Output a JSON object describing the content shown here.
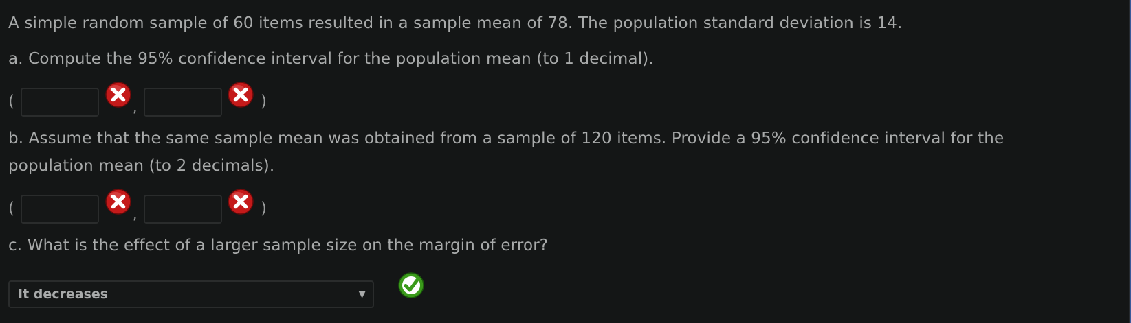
{
  "question": {
    "intro": "A simple random sample of 60 items resulted in a sample mean of 78. The population standard deviation is 14.",
    "part_a": {
      "prompt": "a. Compute the 95% confidence interval for the population mean (to 1 decimal).",
      "open_paren": "(",
      "comma": ",",
      "close_paren": ")",
      "lower_value": "",
      "upper_value": "",
      "lower_status": "incorrect",
      "upper_status": "incorrect"
    },
    "part_b": {
      "prompt_line1": "b. Assume that the same sample mean was obtained from a sample of 120 items. Provide a 95% confidence interval for the",
      "prompt_line2": "population mean (to 2 decimals).",
      "open_paren": "(",
      "comma": ",",
      "close_paren": ")",
      "lower_value": "",
      "upper_value": "",
      "lower_status": "incorrect",
      "upper_status": "incorrect"
    },
    "part_c": {
      "prompt": "c. What is the effect of a larger sample size on the margin of error?",
      "selected_option": "It decreases",
      "dropdown_arrow": "▼",
      "status": "correct"
    }
  },
  "colors": {
    "background": "#141616",
    "text": "#a8aaaa",
    "incorrect_icon": "#c41a1a",
    "correct_icon": "#3a9a1a",
    "edge_accent": "#3a5a9a"
  }
}
